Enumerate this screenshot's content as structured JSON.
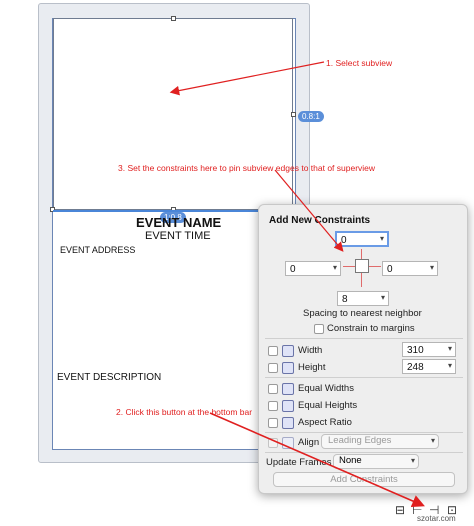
{
  "storyboard": {
    "event_name": "EVENT NAME",
    "event_time": "EVENT TIME",
    "event_address": "EVENT ADDRESS",
    "event_description": "EVENT DESCRIPTION",
    "constraint_tag_right": "0.8:1",
    "constraint_tag_top": "1:0.8"
  },
  "popover": {
    "title": "Add New Constraints",
    "top_value": "0",
    "left_value": "0",
    "right_value": "0",
    "bottom_value": "8",
    "spacing_label": "Spacing to nearest neighbor",
    "constrain_margins": "Constrain to margins",
    "width_label": "Width",
    "width_value": "310",
    "height_label": "Height",
    "height_value": "248",
    "equal_widths": "Equal Widths",
    "equal_heights": "Equal Heights",
    "aspect_ratio": "Aspect Ratio",
    "align_label": "Align",
    "align_value": "Leading Edges",
    "update_frames_label": "Update Frames",
    "update_frames_value": "None",
    "add_button": "Add Constraints"
  },
  "annotations": {
    "a1": "1. Select subview",
    "a2": "2. Click this button at the bottom bar",
    "a3": "3. Set the constraints here to pin subview edges to that of superview"
  },
  "bottom_bar_icons": [
    "align-icon",
    "pin-icon",
    "resolve-icon",
    "resizing-icon"
  ],
  "watermark": "szotar.com",
  "colors": {
    "annotation": "#e02020",
    "selection": "#4a86d8",
    "constraint_red": "#e06b6b"
  }
}
